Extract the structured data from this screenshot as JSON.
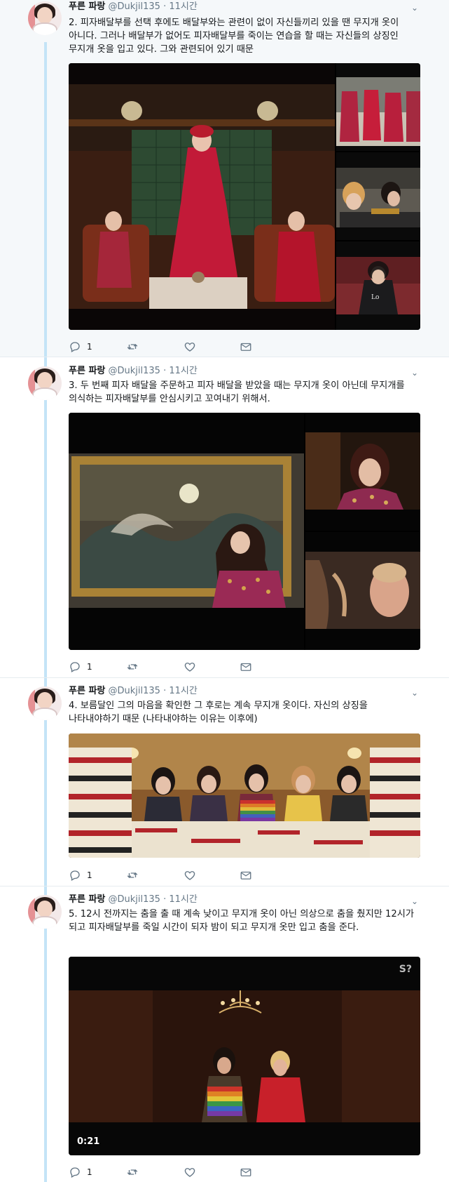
{
  "colors": {
    "accent": "#1da1f2",
    "thread_line": "#c4e4f7",
    "muted": "#657786"
  },
  "tweets": [
    {
      "name": "푸른 파랑",
      "handle": "@Dukjil135",
      "sep": " · ",
      "time": "11시간",
      "text": "2. 피자배달부를 선택 후에도 배달부와는 관련이 없이 자신들끼리 있을 땐 무지개 옷이 아니다. 그러나 배달부가 없어도 피자배달부를 죽이는 연습을 할 때는 자신들의 상징인 무지개 옷을 입고 있다. 그와 관련되어 있기 때문",
      "reply_count": "1",
      "media_icon": "photo-grid"
    },
    {
      "name": "푸른 파랑",
      "handle": "@Dukjil135",
      "sep": " · ",
      "time": "11시간",
      "text": "3. 두 번째 피자 배달을 주문하고 피자 배달을 받았을 때는 무지개 옷이 아닌데 무지개를 의식하는 피자배달부를 안심시키고 꼬여내기 위해서.",
      "reply_count": "1",
      "media_icon": "photo-grid"
    },
    {
      "name": "푸른 파랑",
      "handle": "@Dukjil135",
      "sep": " · ",
      "time": "11시간",
      "text": "4. 보름달인 그의 마음을 확인한 그 후로는 계속 무지개 옷이다. 자신의 상징을 나타내야하기 때문 (나타내야하는 이유는 이후에)",
      "reply_count": "1",
      "media_icon": "photo"
    },
    {
      "name": "푸른 파랑",
      "handle": "@Dukjil135",
      "sep": " · ",
      "time": "11시간",
      "text": "5. 12시 전까지는 춤을 출 때 계속 낮이고 무지개 옷이 아닌 의상으로 춤을 췄지만 12시가 되고 피자배달부를 죽일 시간이 되자 밤이 되고 무지개 옷만 입고 춤을 준다.",
      "reply_count": "1",
      "video_duration": "0:21",
      "video_badge": "S?"
    }
  ]
}
